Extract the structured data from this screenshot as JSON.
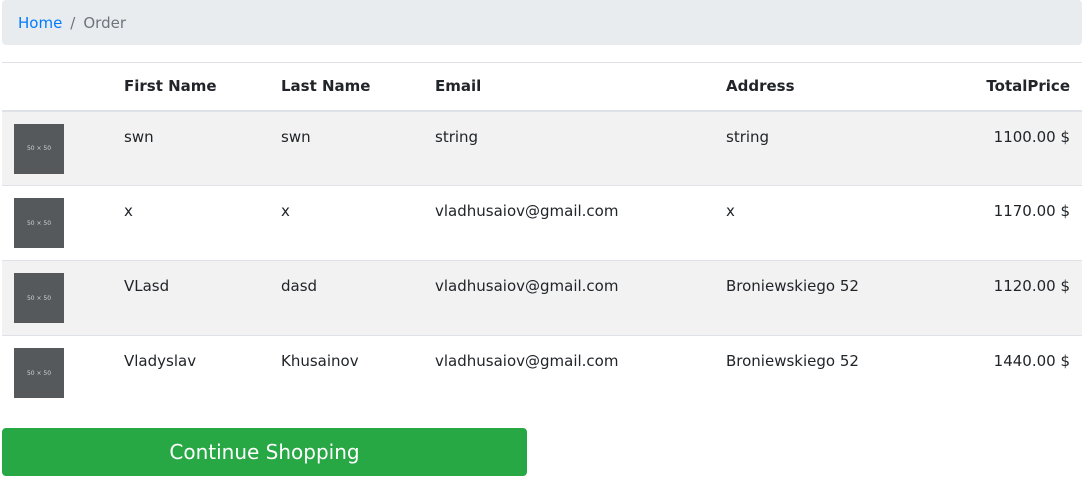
{
  "breadcrumb": {
    "home": "Home",
    "separator": "/",
    "current": "Order"
  },
  "table": {
    "headers": {
      "image": "",
      "first_name": "First Name",
      "last_name": "Last Name",
      "email": "Email",
      "address": "Address",
      "total_price": "TotalPrice"
    },
    "rows": [
      {
        "thumb": "50 × 50",
        "first_name": "swn",
        "last_name": "swn",
        "email": "string",
        "address": "string",
        "total_price": "1100.00 $"
      },
      {
        "thumb": "50 × 50",
        "first_name": "x",
        "last_name": "x",
        "email": "vladhusaiov@gmail.com",
        "address": "x",
        "total_price": "1170.00 $"
      },
      {
        "thumb": "50 × 50",
        "first_name": "VLasd",
        "last_name": "dasd",
        "email": "vladhusaiov@gmail.com",
        "address": "Broniewskiego 52",
        "total_price": "1120.00 $"
      },
      {
        "thumb": "50 × 50",
        "first_name": "Vladyslav",
        "last_name": "Khusainov",
        "email": "vladhusaiov@gmail.com",
        "address": "Broniewskiego 52",
        "total_price": "1440.00 $"
      }
    ]
  },
  "actions": {
    "continue_shopping": "Continue Shopping"
  },
  "colors": {
    "link": "#007bff",
    "success": "#28a745",
    "breadcrumb_bg": "#e9ecef",
    "stripe": "#f2f2f2",
    "thumb": "#55595c"
  }
}
